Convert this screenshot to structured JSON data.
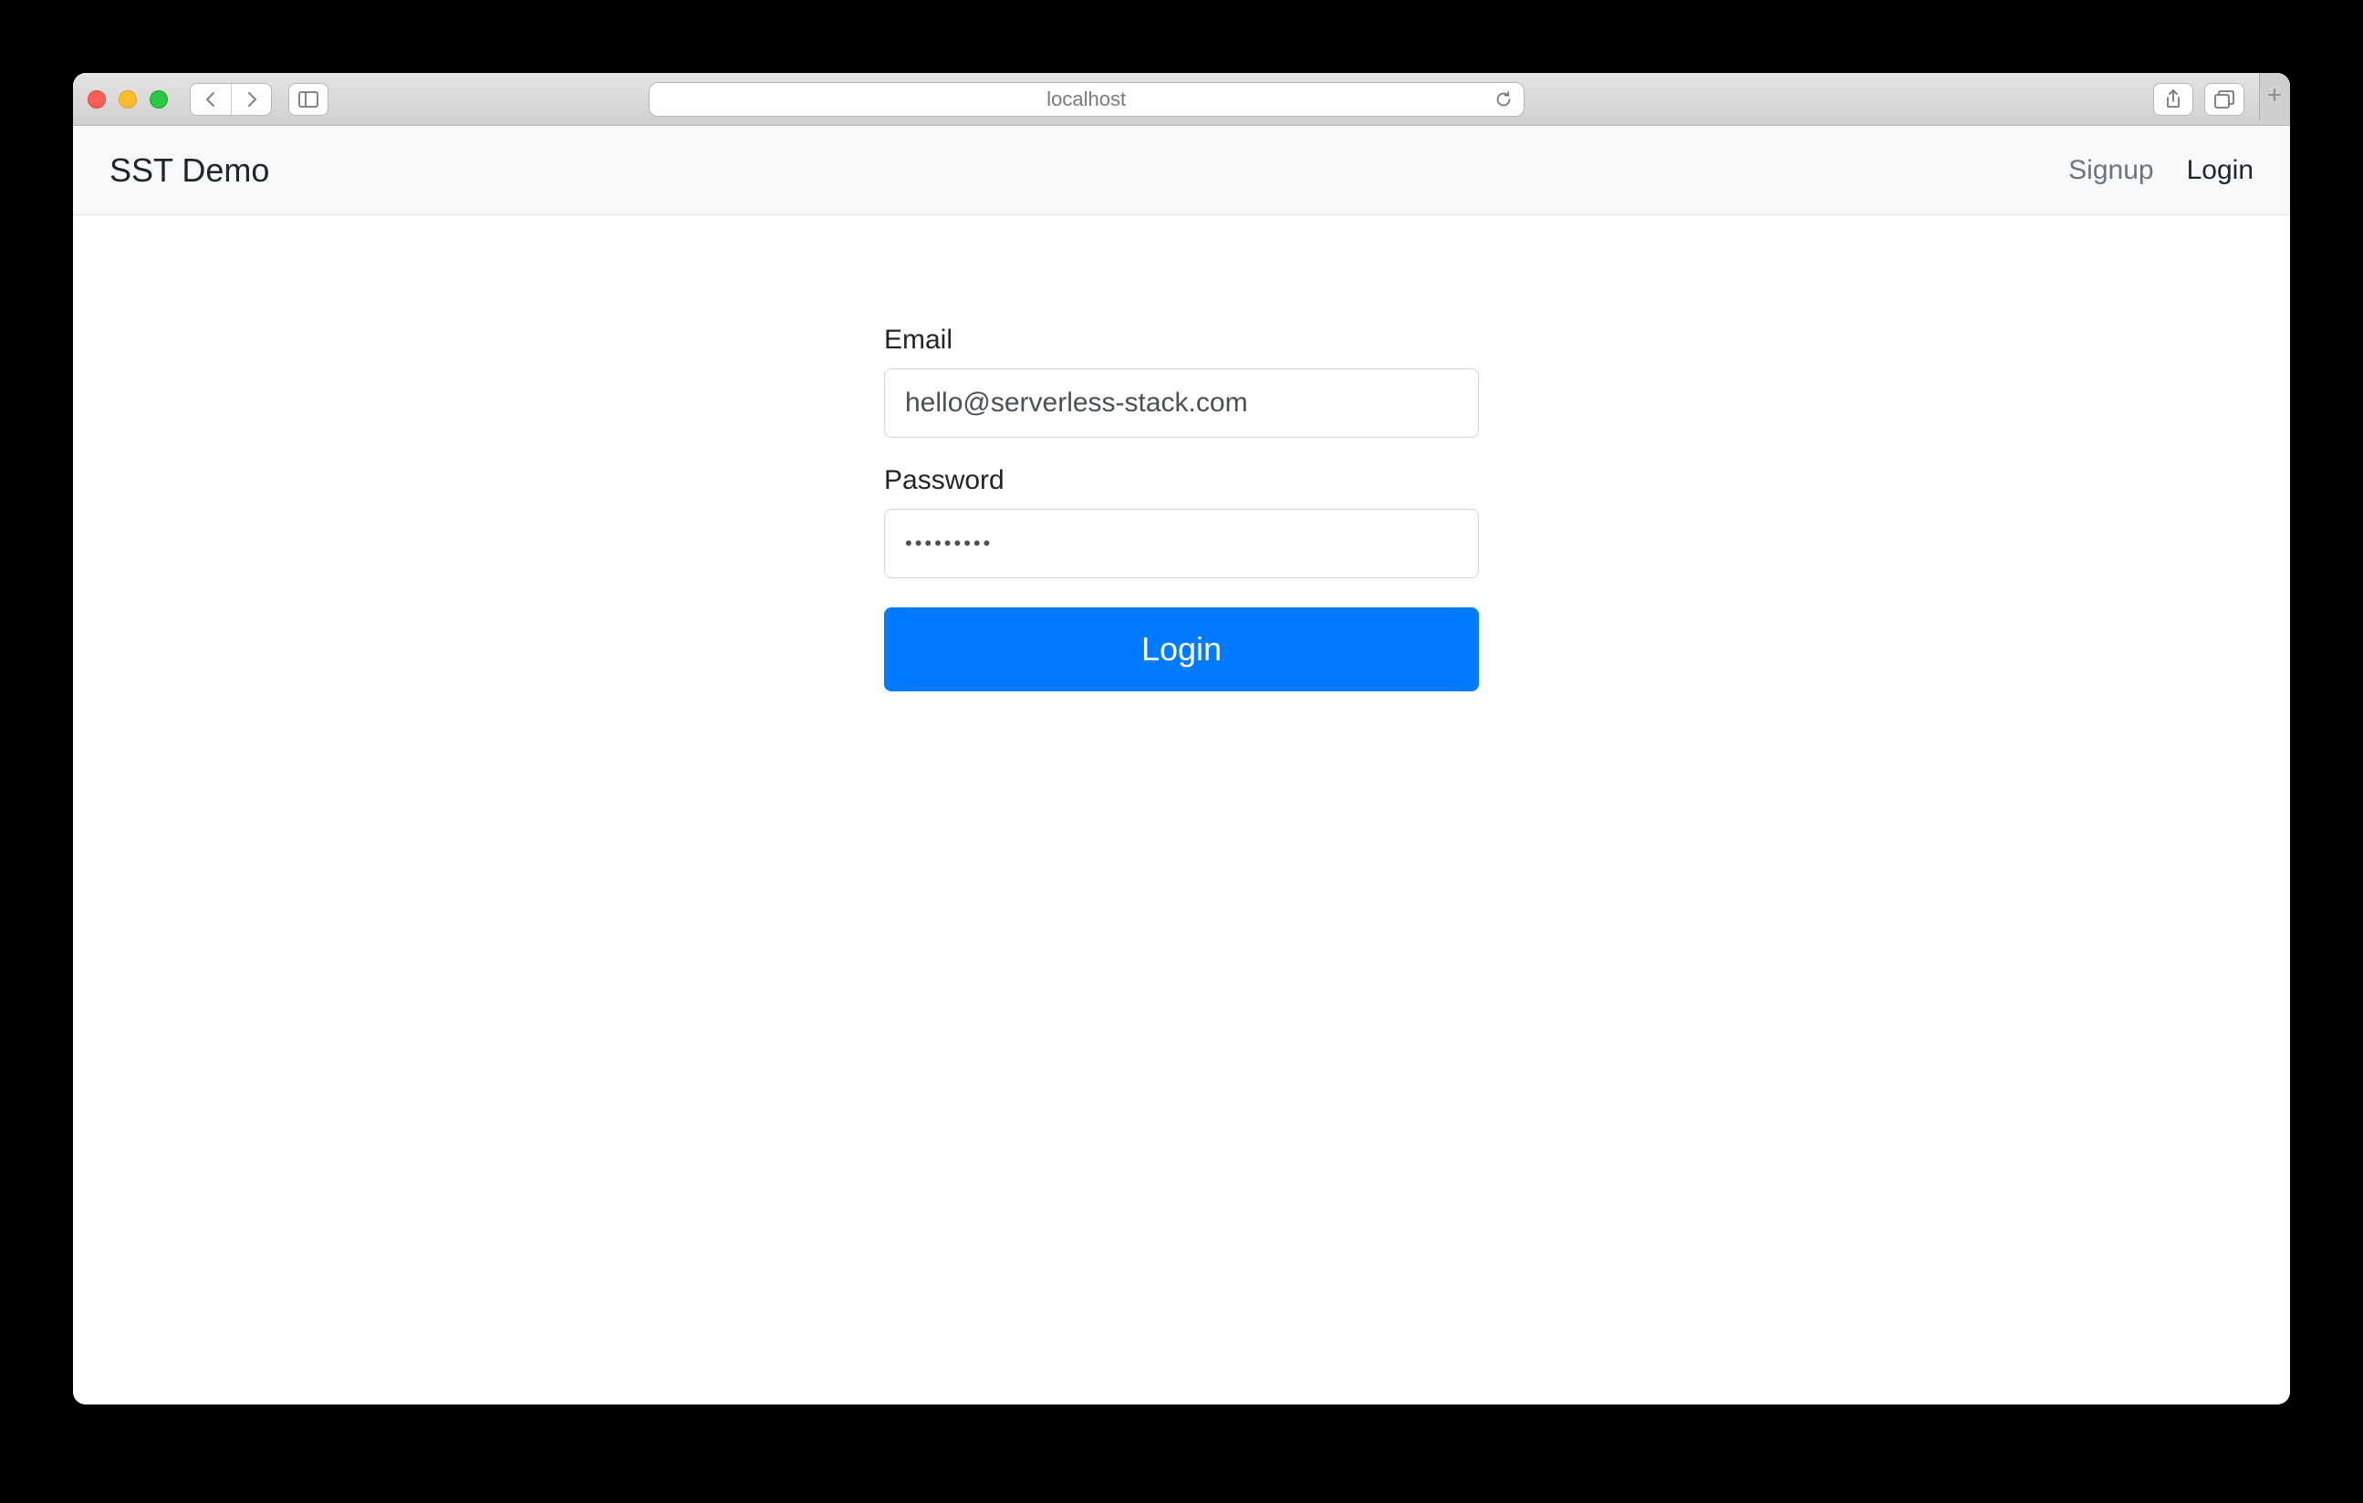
{
  "browser": {
    "url": "localhost"
  },
  "nav": {
    "brand": "SST Demo",
    "signup": "Signup",
    "login": "Login"
  },
  "form": {
    "email_label": "Email",
    "email_value": "hello@serverless-stack.com",
    "password_label": "Password",
    "password_value": "•••••••••",
    "submit_label": "Login"
  }
}
